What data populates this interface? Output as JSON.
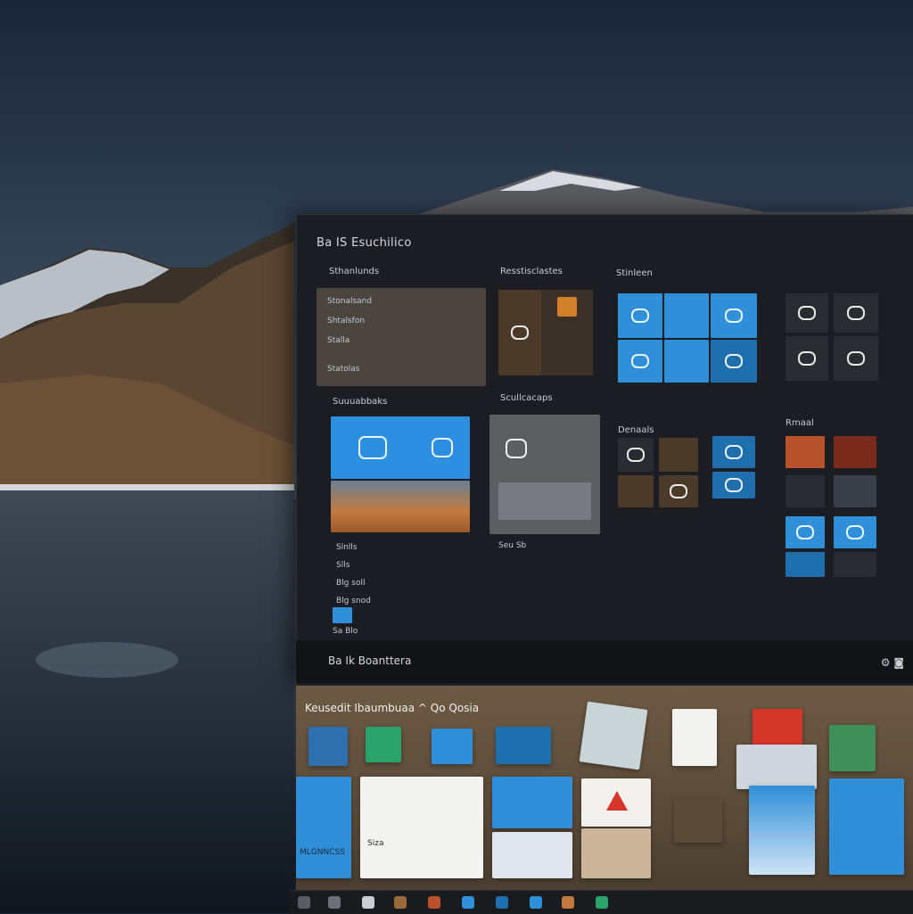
{
  "start_panel": {
    "header": "Ba  IS  Esuchilico",
    "groups": [
      {
        "title": "Sthanlunds"
      },
      {
        "title": "Resstisclastes"
      },
      {
        "title": "Stinleen"
      },
      {
        "title": "Suuuabbaks"
      },
      {
        "title": "Scullcacaps"
      },
      {
        "title": "Denaals"
      },
      {
        "title": "Rmaal"
      }
    ],
    "list_items": [
      "Stonalsand",
      "Shtalsfon",
      "Stalla",
      "Statolas"
    ],
    "left_labels": [
      "Slnlls",
      "Slls",
      "Blg soll",
      "Blg snod"
    ],
    "bottom_label": "Sa  Blo",
    "photo_caption": "Seu Sb"
  },
  "footer": {
    "label": "Ba  Ik  Boanttera",
    "icons": [
      "settings-icon",
      "camera-icon"
    ]
  },
  "second_window": {
    "title": "Keusedit Ibaumbuaa  ^  Qo   Qosia",
    "small_tile_labels": [
      "MLGNNCSS",
      "Siza"
    ]
  },
  "colors": {
    "accent_blue": "#2f8fd8",
    "panel_bg": "#1c1d22",
    "window_brown": "#5b4b39"
  }
}
